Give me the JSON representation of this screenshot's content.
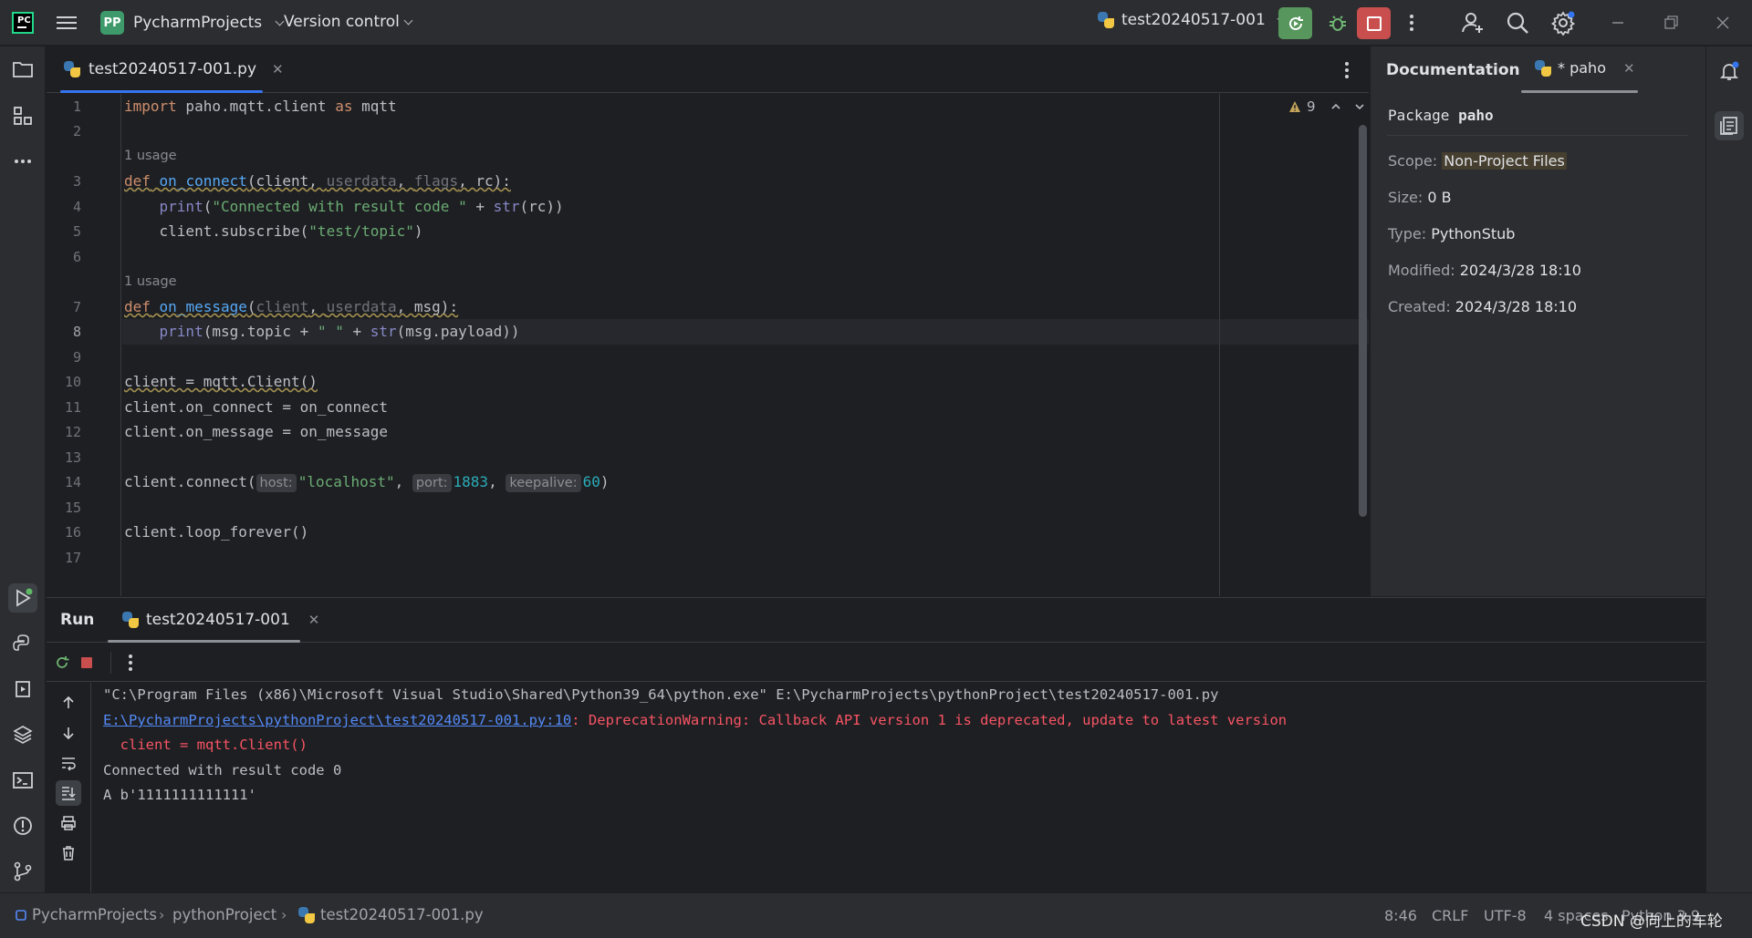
{
  "titlebar": {
    "project_initials": "PP",
    "project_name": "PycharmProjects",
    "vcs_label": "Version control",
    "run_config": "test20240517-001"
  },
  "editor": {
    "tab_name": "test20240517-001.py",
    "warning_count": "9",
    "line_numbers": [
      "1",
      "2",
      "3",
      "4",
      "5",
      "6",
      "7",
      "8",
      "9",
      "10",
      "11",
      "12",
      "13",
      "14",
      "15",
      "16",
      "17"
    ],
    "usage_hint": "1 usage",
    "lines": {
      "l1_kw1": "import",
      "l1_mod": " paho.mqtt.client ",
      "l1_kw2": "as",
      "l1_alias": " mqtt",
      "l3_def": "def",
      "l3_fn": "on_connect",
      "l3_p_open": "(client, ",
      "l3_p_userdata": "userdata",
      "l3_comma1": ", ",
      "l3_p_flags": "flags",
      "l3_p_rest": ", rc):",
      "l4_indent": "    ",
      "l4_print": "print",
      "l4_open": "(",
      "l4_str": "\"Connected with result code \"",
      "l4_plus": " + ",
      "l4_str_fn": "str",
      "l4_rest": "(rc))",
      "l5_text": "    client.subscribe(",
      "l5_str": "\"test/topic\"",
      "l5_close": ")",
      "l7_def": "def",
      "l7_fn": "on_message",
      "l7_open": "(",
      "l7_client": "client",
      "l7_comma": ", ",
      "l7_userdata": "userdata",
      "l7_rest": ", msg):",
      "l8_indent": "    ",
      "l8_print": "print",
      "l8_mid": "(msg.topic + ",
      "l8_str": "\" \"",
      "l8_plus": " + ",
      "l8_str_fn": "str",
      "l8_rest": "(msg.payload))",
      "l10_text": "client = mqtt.Client()",
      "l11_text": "client.on_connect = on_connect",
      "l12_text": "client.on_message = on_message",
      "l14_call": "client.connect(",
      "l14_hint_host": "host:",
      "l14_host": "\"localhost\"",
      "l14_comma": ", ",
      "l14_hint_port": "port:",
      "l14_port": "1883",
      "l14_comma2": ", ",
      "l14_hint_keepalive": "keepalive:",
      "l14_keepalive": "60",
      "l14_close": ")",
      "l16_text": "client.loop_forever()"
    }
  },
  "documentation": {
    "title": "Documentation",
    "tab_label": "* paho",
    "package_prefix": "Package ",
    "package_name": "paho",
    "scope_label": "Scope: ",
    "scope_value": "Non-Project Files",
    "size_label": "Size: ",
    "size_value": "0 B",
    "type_label": "Type: ",
    "type_value": "PythonStub",
    "modified_label": "Modified: ",
    "modified_value": "2024/3/28 18:10",
    "created_label": "Created: ",
    "created_value": "2024/3/28 18:10"
  },
  "run": {
    "title": "Run",
    "tab_label": "test20240517-001",
    "console": {
      "cmd": "\"C:\\Program Files (x86)\\Microsoft Visual Studio\\Shared\\Python39_64\\python.exe\" E:\\PycharmProjects\\pythonProject\\test20240517-001.py",
      "warn_link": "E:\\PycharmProjects\\pythonProject\\test20240517-001.py:10",
      "warn_text": ": DeprecationWarning: Callback API version 1 is deprecated, update to latest version",
      "warn_code": "  client = mqtt.Client()",
      "out1": "Connected with result code 0",
      "out2": "A b'1111111111111'"
    }
  },
  "statusbar": {
    "crumb1": "PycharmProjects",
    "crumb2": "pythonProject",
    "crumb3": "test20240517-001.py",
    "position": "8:46",
    "line_sep": "CRLF",
    "encoding": "UTF-8",
    "indent": "4 spaces",
    "interpreter": "Python 3.9",
    "watermark": "CSDN @向上的车轮"
  }
}
